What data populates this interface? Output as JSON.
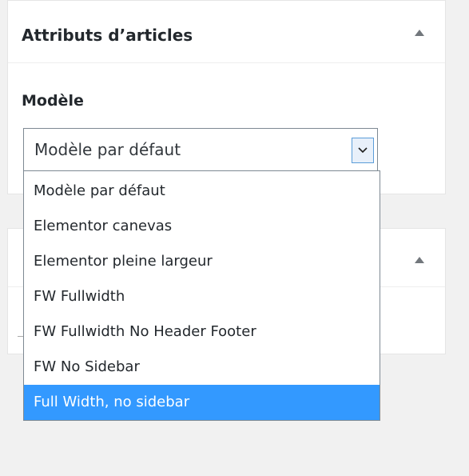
{
  "attributes_panel": {
    "title": "Attributs d’articles",
    "toggle_icon": "triangle-up-icon"
  },
  "template_field": {
    "label": "Modèle",
    "selected_value": "Modèle par défaut",
    "arrow_icon": "chevron-down-icon",
    "options": [
      "Modèle par défaut",
      "Elementor canevas",
      "Elementor pleine largeur",
      "FW Fullwidth",
      "FW Fullwidth No Header Footer",
      "FW No Sidebar",
      "Full Width, no sidebar"
    ],
    "highlighted_option": "Full Width, no sidebar"
  },
  "second_panel": {
    "toggle_icon": "triangle-up-icon"
  },
  "colors": {
    "page_background": "#f1f1f1",
    "panel_background": "#ffffff",
    "highlight": "#3399ff",
    "select_border": "#7e8993",
    "arrow_focus_border": "#5b9dd9"
  }
}
